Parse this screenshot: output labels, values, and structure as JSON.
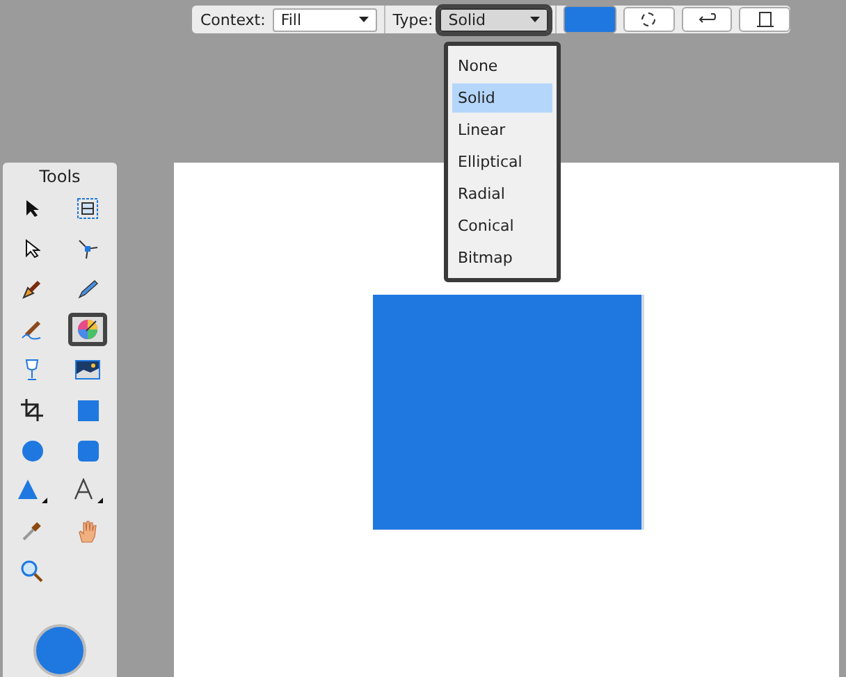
{
  "toolbar": {
    "context_label": "Context:",
    "context_value": "Fill",
    "type_label": "Type:",
    "type_value": "Solid",
    "type_open": true
  },
  "type_menu": [
    {
      "label": "None",
      "selected": false
    },
    {
      "label": "Solid",
      "selected": true
    },
    {
      "label": "Linear",
      "selected": false
    },
    {
      "label": "Elliptical",
      "selected": false
    },
    {
      "label": "Radial",
      "selected": false
    },
    {
      "label": "Conical",
      "selected": false
    },
    {
      "label": "Bitmap",
      "selected": false
    }
  ],
  "tools": {
    "title": "Tools",
    "items": [
      {
        "kind": "pointer",
        "selected": false
      },
      {
        "kind": "artboard",
        "selected": false
      },
      {
        "kind": "node",
        "selected": false
      },
      {
        "kind": "cornertool",
        "selected": false
      },
      {
        "kind": "pen",
        "selected": false
      },
      {
        "kind": "pencil",
        "selected": false
      },
      {
        "kind": "brush",
        "selected": false
      },
      {
        "kind": "fill",
        "selected": true
      },
      {
        "kind": "transparency",
        "selected": false
      },
      {
        "kind": "place",
        "selected": false
      },
      {
        "kind": "crop",
        "selected": false
      },
      {
        "kind": "rectangle",
        "selected": false
      },
      {
        "kind": "ellipse",
        "selected": false
      },
      {
        "kind": "rounded",
        "selected": false
      },
      {
        "kind": "triangle",
        "selected": false
      },
      {
        "kind": "text",
        "selected": false
      },
      {
        "kind": "picker",
        "selected": false
      },
      {
        "kind": "hand",
        "selected": false
      },
      {
        "kind": "zoom",
        "selected": false
      }
    ]
  }
}
